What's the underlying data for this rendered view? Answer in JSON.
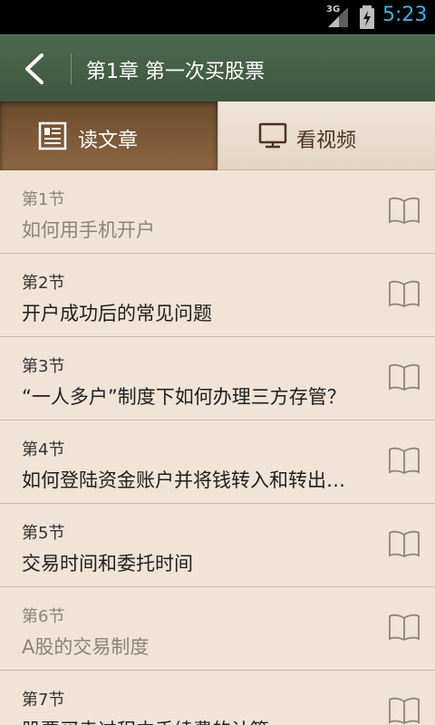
{
  "status_bar": {
    "network": "3G",
    "time": "5:23"
  },
  "header": {
    "title": "第1章 第一次买股票",
    "back_icon": "back-arrow-icon"
  },
  "tabs": [
    {
      "label": "读文章",
      "icon": "article-icon",
      "selected": true
    },
    {
      "label": "看视频",
      "icon": "monitor-icon",
      "selected": false
    }
  ],
  "sections": [
    {
      "number": "第1节",
      "title": "如何用手机开户",
      "read": true
    },
    {
      "number": "第2节",
      "title": "开户成功后的常见问题",
      "read": false
    },
    {
      "number": "第3节",
      "title": "“一人多户”制度下如何办理三方存管？",
      "read": false
    },
    {
      "number": "第4节",
      "title": "如何登陆资金账户并将钱转入和转出…",
      "read": false
    },
    {
      "number": "第5节",
      "title": "交易时间和委托时间",
      "read": false
    },
    {
      "number": "第6节",
      "title": "A股的交易制度",
      "read": true
    },
    {
      "number": "第7节",
      "title": "股票买卖过程中手续费的计算",
      "read": false
    }
  ],
  "colors": {
    "header": "#435f45",
    "tab_selected": "#7a5736",
    "list_bg": "#efe4d6",
    "clock": "#33b5e5"
  }
}
